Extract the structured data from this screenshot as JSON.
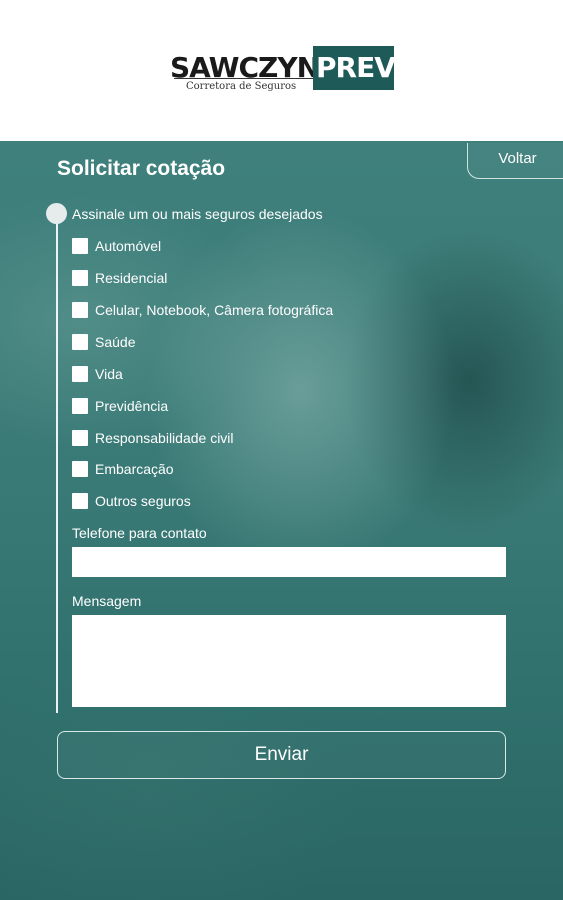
{
  "header": {
    "logo_left": "SAWCZYN",
    "logo_right": "PREV",
    "logo_subtitle": "Corretora de Seguros"
  },
  "nav": {
    "back_label": "Voltar"
  },
  "form": {
    "title": "Solicitar cotação",
    "section_label": "Assinale um ou mais seguros desejados",
    "options": [
      {
        "label": "Automóvel",
        "checked": false
      },
      {
        "label": "Residencial",
        "checked": false
      },
      {
        "label": "Celular, Notebook, Câmera fotográfica",
        "checked": false
      },
      {
        "label": "Saúde",
        "checked": false
      },
      {
        "label": "Vida",
        "checked": false
      },
      {
        "label": "Previdência",
        "checked": false
      },
      {
        "label": "Responsabilidade civil",
        "checked": false
      },
      {
        "label": "Embarcação",
        "checked": false
      },
      {
        "label": "Outros seguros",
        "checked": false
      }
    ],
    "phone_label": "Telefone para contato",
    "phone_value": "",
    "message_label": "Mensagem",
    "message_value": "",
    "submit_label": "Enviar"
  },
  "colors": {
    "accent": "#1e5a58",
    "background": "#3a7a76"
  }
}
